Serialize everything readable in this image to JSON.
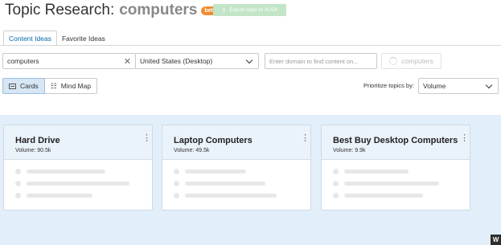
{
  "header": {
    "title": "Topic Research:",
    "query": "computers",
    "beta_badge": "beta",
    "export_label": "Export topic to XLSX"
  },
  "tabs": [
    {
      "label": "Content Ideas",
      "active": true
    },
    {
      "label": "Favorite Ideas",
      "active": false
    }
  ],
  "search": {
    "value": "computers",
    "region": "United States (Desktop)",
    "domain_placeholder": "Enter domain to find content on...",
    "submit_label": "computers"
  },
  "view": {
    "cards_label": "Cards",
    "mindmap_label": "Mind Map",
    "prioritize_label": "Prioritize topics by:",
    "prioritize_value": "Volume"
  },
  "cards": [
    {
      "title": "Hard Drive",
      "volume": "Volume: 90.5k"
    },
    {
      "title": "Laptop Computers",
      "volume": "Volume: 49.5k"
    },
    {
      "title": "Best Buy Desktop Computers",
      "volume": "Volume: 9.9k"
    }
  ],
  "colors": {
    "accent": "#0068a8",
    "beta": "#f08c2f",
    "export_button": "#c3e5c7",
    "board_bg": "#e2eef9"
  }
}
